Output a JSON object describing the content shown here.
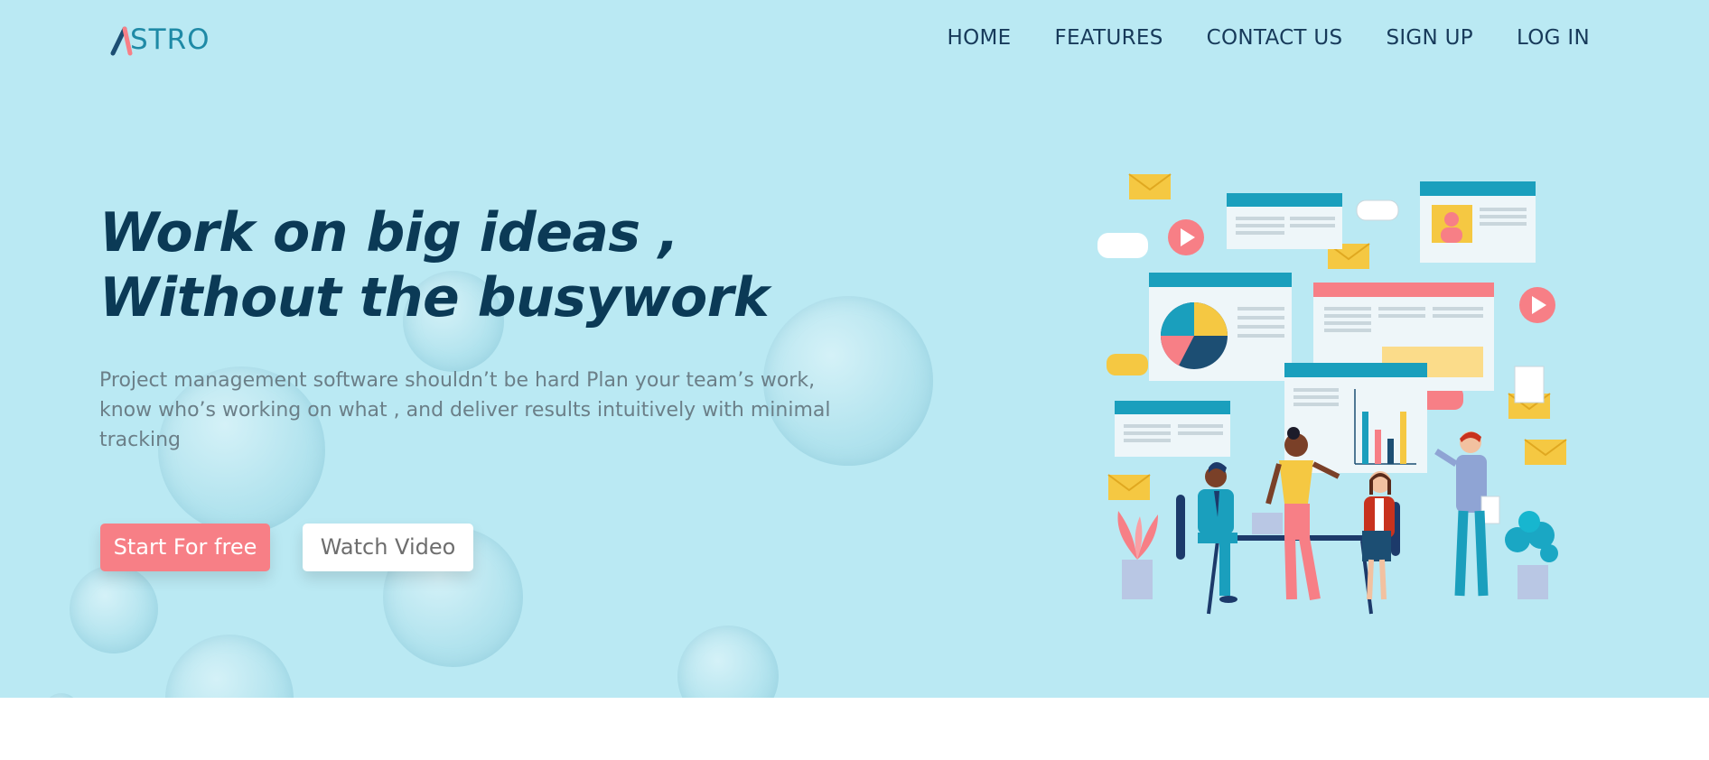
{
  "brand": {
    "logo_text": "ASTRO",
    "logo_text_rest": "STRO"
  },
  "nav": {
    "items": [
      {
        "label": "HOME"
      },
      {
        "label": "FEATURES"
      },
      {
        "label": "CONTACT US"
      },
      {
        "label": "SIGN UP"
      },
      {
        "label": "LOG IN"
      }
    ]
  },
  "hero": {
    "headline_line1": "Work on big ideas ,",
    "headline_line2": "Without the busywork",
    "description": "Project management software shouldn’t be hard Plan your team’s work, know who’s working on what , and deliver results intuitively with minimal tracking",
    "primary_button": "Start For free",
    "secondary_button": "Watch Video",
    "illustration": "team-meeting-dashboard-illustration"
  },
  "colors": {
    "hero_bg": "#bae9f3",
    "headline": "#0b3a56",
    "primary_button": "#f77f86",
    "accent_teal": "#1f8aa6"
  }
}
